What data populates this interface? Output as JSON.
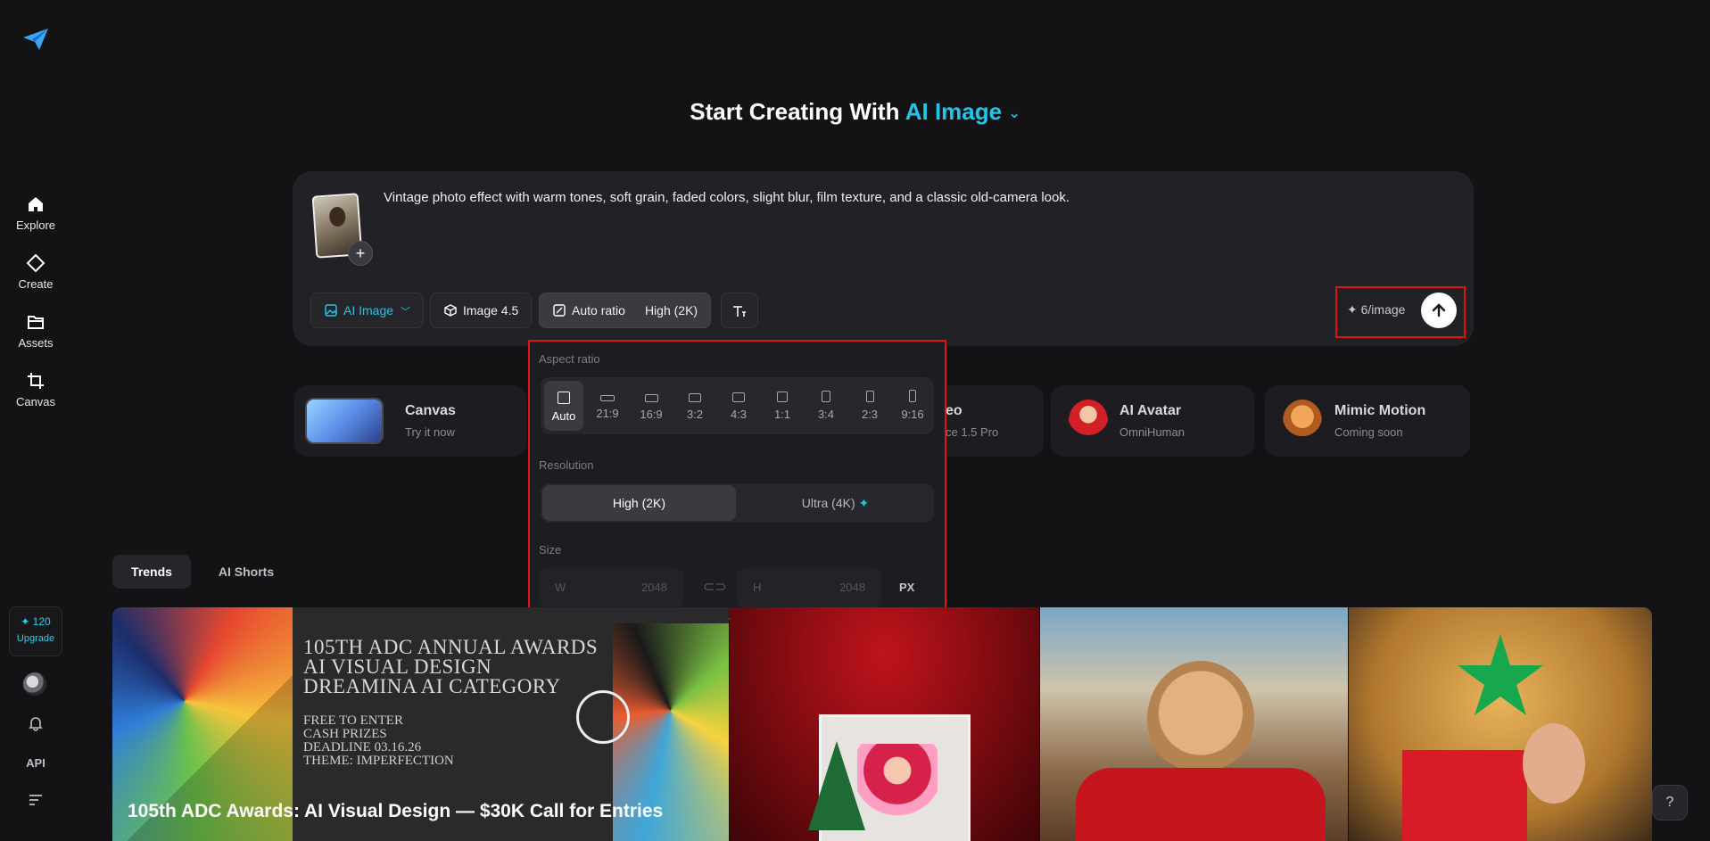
{
  "sidebar": {
    "items": [
      {
        "label": "Explore",
        "icon": "home-icon"
      },
      {
        "label": "Create",
        "icon": "diamond-icon"
      },
      {
        "label": "Assets",
        "icon": "folder-icon"
      },
      {
        "label": "Canvas",
        "icon": "crop-icon"
      }
    ],
    "credits": "✦ 120",
    "upgrade": "Upgrade",
    "api": "API"
  },
  "headline": {
    "prefix": "Start Creating With",
    "accent": "AI Image"
  },
  "prompt": {
    "text": "Vintage photo effect with warm tones, soft grain, faded colors, slight blur, film texture, and a classic old-camera look."
  },
  "toolbar": {
    "model": "AI Image",
    "version": "Image 4.5",
    "ratio": "Auto ratio",
    "quality": "High (2K)",
    "cost": "✦ 6/image"
  },
  "features": [
    {
      "title": "Canvas",
      "sub": "Try it now"
    },
    {
      "title": "eo",
      "sub": "ce 1.5 Pro"
    },
    {
      "title": "AI Avatar",
      "sub": "OmniHuman"
    },
    {
      "title": "Mimic Motion",
      "sub": "Coming soon"
    }
  ],
  "popover": {
    "aspect_label": "Aspect ratio",
    "ratios": [
      "Auto",
      "21:9",
      "16:9",
      "3:2",
      "4:3",
      "1:1",
      "3:4",
      "2:3",
      "9:16"
    ],
    "selected_ratio": "Auto",
    "resolution_label": "Resolution",
    "resolutions": [
      "High (2K)",
      "Ultra (4K)"
    ],
    "selected_resolution": "High (2K)",
    "size_label": "Size",
    "width_label": "W",
    "width_value": "2048",
    "height_label": "H",
    "height_value": "2048",
    "unit": "PX"
  },
  "tabs": [
    "Trends",
    "AI Shorts"
  ],
  "feed": {
    "featured_caption": "105th ADC Awards: AI Visual Design — $30K Call for Entries",
    "poster_lines": [
      "105TH ADC ANNUAL AWARDS",
      "AI VISUAL DESIGN",
      "DREAMINA AI CATEGORY"
    ],
    "poster_details": [
      "FREE TO ENTER",
      "CASH PRIZES",
      "DEADLINE 03.16.26",
      "THEME: IMPERFECTION"
    ]
  },
  "colors": {
    "accent": "#22c4e8",
    "highlight": "#e3121a",
    "background": "#131315"
  }
}
